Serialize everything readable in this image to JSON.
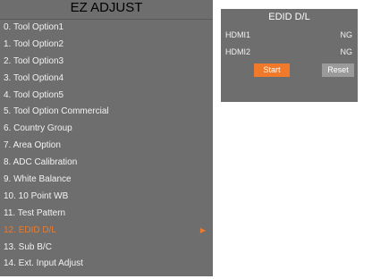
{
  "menu": {
    "title": "EZ ADJUST",
    "items": [
      {
        "label": "0. Tool Option1"
      },
      {
        "label": "1. Tool Option2"
      },
      {
        "label": "2. Tool Option3"
      },
      {
        "label": "3. Tool Option4"
      },
      {
        "label": "4. Tool Option5"
      },
      {
        "label": "5. Tool Option Commercial"
      },
      {
        "label": "6. Country Group"
      },
      {
        "label": "7. Area Option"
      },
      {
        "label": "8. ADC Calibration"
      },
      {
        "label": "9. White Balance"
      },
      {
        "label": "10. 10 Point WB"
      },
      {
        "label": "11. Test Pattern"
      },
      {
        "label": "12. EDID D/L",
        "selected": true
      },
      {
        "label": "13. Sub B/C"
      },
      {
        "label": "14. Ext. Input Adjust"
      }
    ],
    "arrow_icon": "right-triangle-icon",
    "arrow_glyph": "▶"
  },
  "edid": {
    "title": "EDID D/L",
    "rows": [
      {
        "port": "HDMI1",
        "status": "NG"
      },
      {
        "port": "HDMI2",
        "status": "NG"
      }
    ],
    "start_label": "Start",
    "reset_label": "Reset"
  },
  "colors": {
    "panel_bg": "#6e6e6e",
    "text": "#f2f2f2",
    "accent": "#f07a2a",
    "reset_button": "#9a9a9a"
  }
}
